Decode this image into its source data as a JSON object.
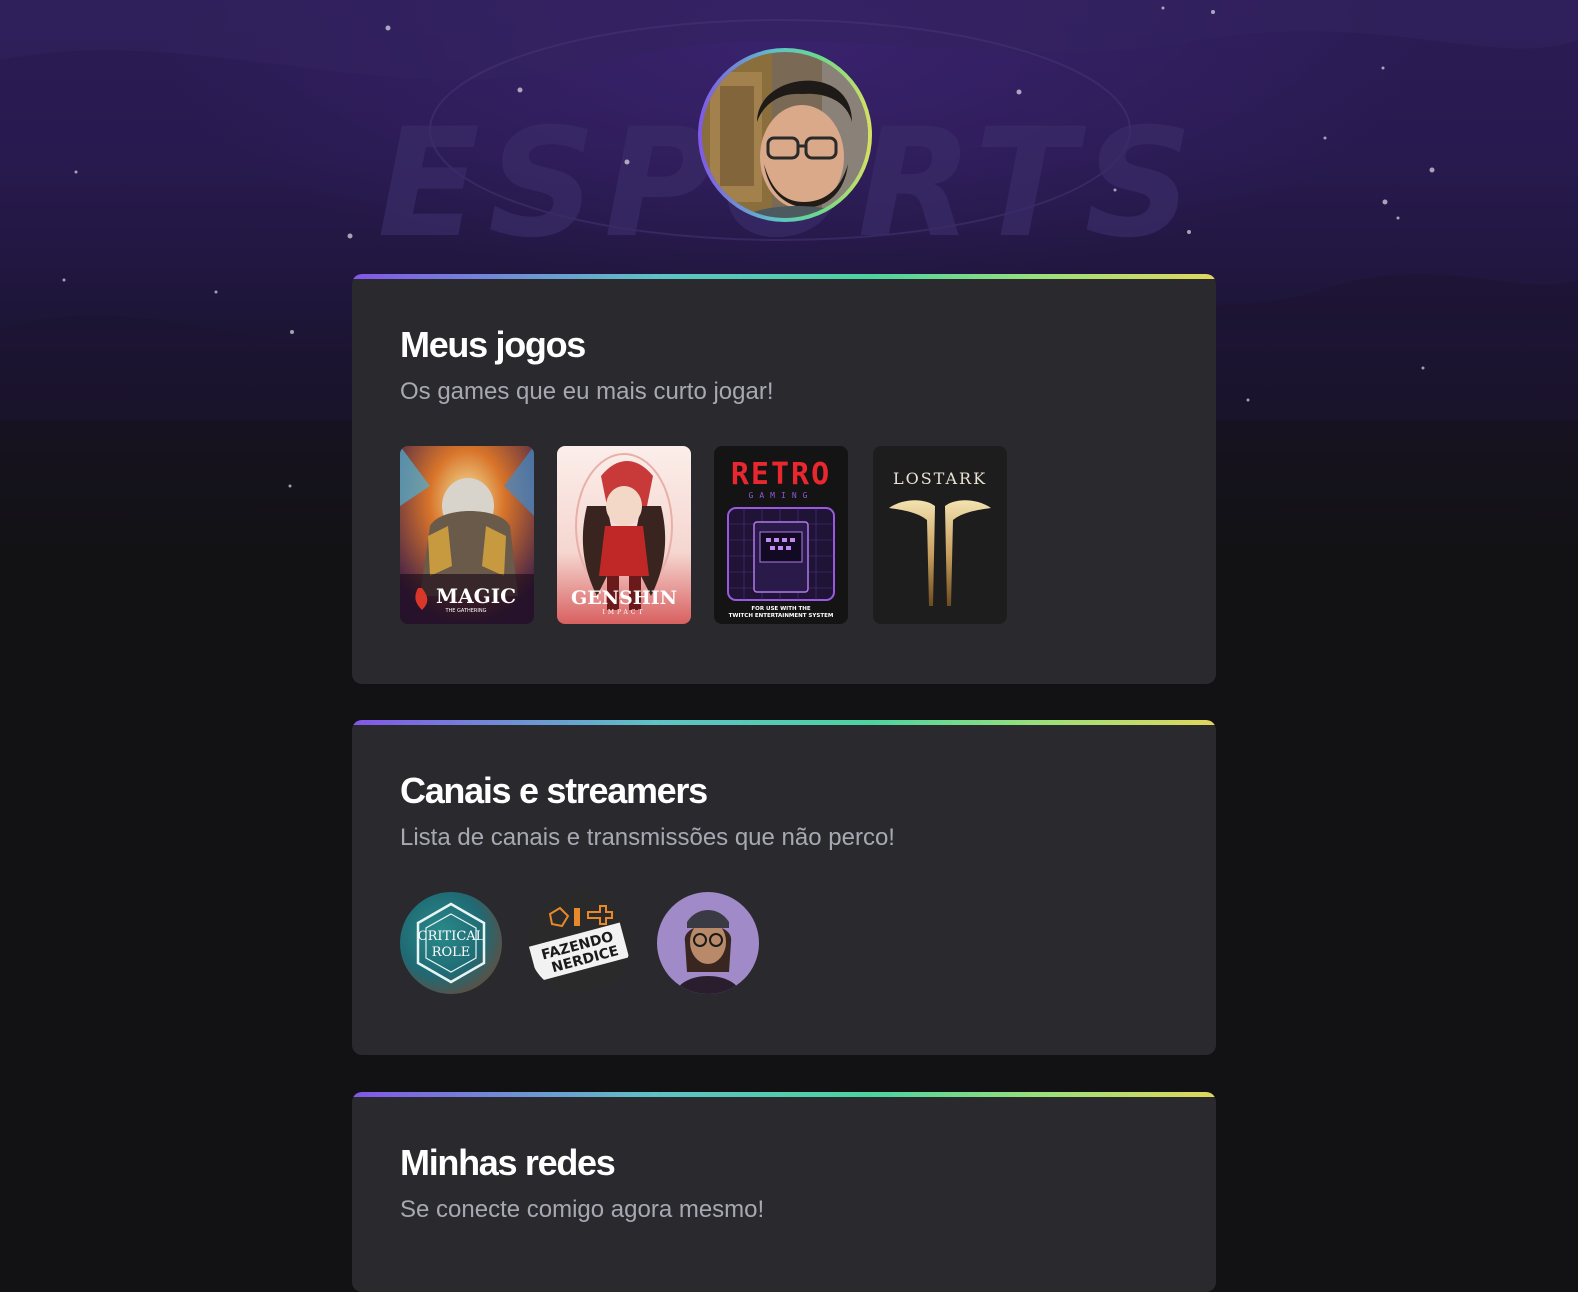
{
  "profile": {
    "avatar_alt": "Foto de perfil",
    "background_word": "ESPORTS"
  },
  "sections": {
    "games": {
      "title": "Meus jogos",
      "subtitle": "Os games que eu mais curto jogar!",
      "items": [
        {
          "name": "Magic: The Gathering",
          "logo": "MAGIC",
          "logo_sub": "THE GATHERING"
        },
        {
          "name": "Genshin Impact",
          "logo": "GENSHIN",
          "logo_sub": "IMPACT"
        },
        {
          "name": "Retro Gaming",
          "logo": "RETRO",
          "logo_sub": "GAMING",
          "footer_1": "FOR USE WITH THE",
          "footer_2": "TWITCH ENTERTAINMENT SYSTEM"
        },
        {
          "name": "Lost Ark",
          "logo": "LOSTARK"
        }
      ]
    },
    "channels": {
      "title": "Canais e streamers",
      "subtitle": "Lista de canais e transmissões que não perco!",
      "items": [
        {
          "name": "Critical Role",
          "logo_1": "CRITICAL",
          "logo_2": "ROLE"
        },
        {
          "name": "Fazendo Nerdice",
          "logo_1": "FAZENDO",
          "logo_2": "NERDICE"
        },
        {
          "name": "Streamer"
        }
      ]
    },
    "social": {
      "title": "Minhas redes",
      "subtitle": "Se conecte comigo agora mesmo!"
    }
  },
  "colors": {
    "page_bg": "#121214",
    "card_bg": "#29292e",
    "accent_gradient": [
      "#8257e6",
      "#5ec2c6",
      "#4cd3a0",
      "#e2d65c"
    ],
    "title": "#ffffff",
    "subtitle": "#a8a8b3"
  }
}
